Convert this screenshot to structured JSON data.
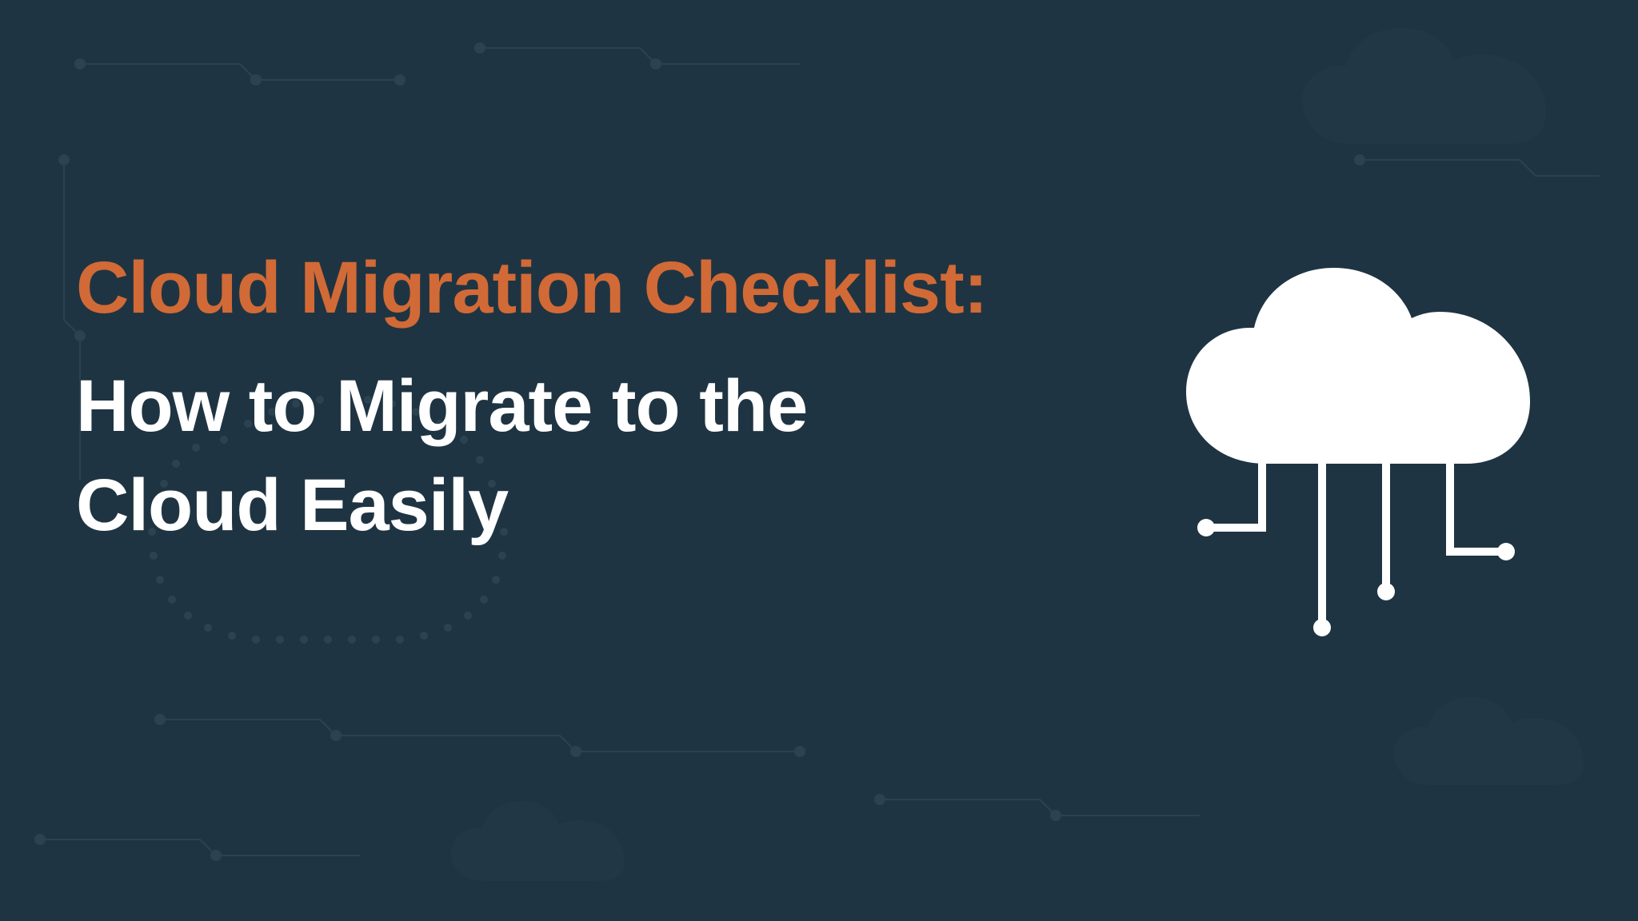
{
  "hero": {
    "title_accent": "Cloud Migration Checklist:",
    "title_main_line1": "How to Migrate to the",
    "title_main_line2": "Cloud Easily"
  },
  "colors": {
    "accent": "#d16a36",
    "background": "#1f3442",
    "text": "#ffffff"
  },
  "icons": {
    "main": "cloud-network-icon"
  }
}
